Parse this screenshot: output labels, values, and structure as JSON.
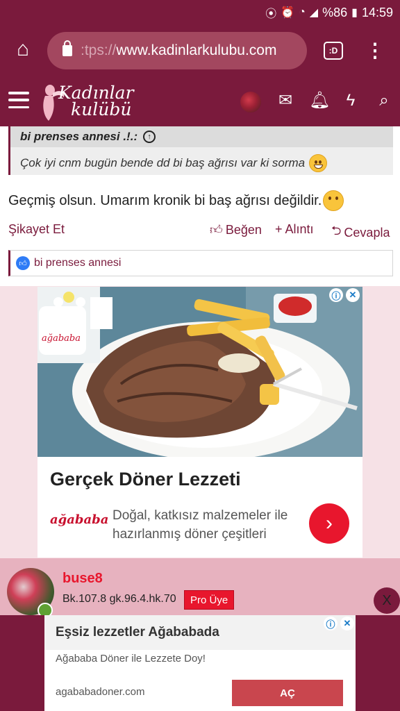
{
  "status_bar": {
    "battery": "%86",
    "time": "14:59"
  },
  "browser": {
    "url_prefix": ":tps://",
    "url_host": "www.kadinlarkulubu.com",
    "tabs_label": ":D"
  },
  "site": {
    "logo_line1": "Kadınlar",
    "logo_line2": "kulübü"
  },
  "post": {
    "quote_author": "bi prenses annesi .!.:",
    "quote_text": "Çok iyi cnm bugün bende dd bi baş ağrısı var ki sorma",
    "message": "Geçmiş olsun. Umarım kronik bi baş ağrısı değildir.",
    "actions": {
      "report": "Şikayet Et",
      "like": "Beğen",
      "quote": "Alıntı",
      "reply": "Cevapla"
    },
    "reactions_user": "bi prenses annesi"
  },
  "ad1": {
    "photo_brand": "ağababa",
    "headline": "Gerçek Döner Lezzeti",
    "brand": "ağababa",
    "description": "Doğal, katkısız malzemeler ile hazırlanmış döner çeşitleri"
  },
  "author": {
    "name": "buse8",
    "stats": "Bk.107.8 gk.96.4.hk.70",
    "badge": "Pro Üye",
    "close": "X"
  },
  "ad2": {
    "title": "Eşsiz lezzetler Ağababada",
    "subtitle": "Ağababa Döner ile Lezzete Doy!",
    "url": "agababadoner.com",
    "button": "AÇ"
  },
  "colors": {
    "brand": "#7a1a3c",
    "accent_red": "#e8162d",
    "author_bar": "#e7b2bf",
    "like_blue": "#2f7cf6"
  },
  "icons": [
    "location-icon",
    "alarm-icon",
    "wifi-icon",
    "signal-icon",
    "battery-icon",
    "home-icon",
    "lock-icon",
    "tabs-icon",
    "kebab-menu-icon",
    "hamburger-icon",
    "mail-icon",
    "bell-icon",
    "lightning-icon",
    "search-icon",
    "like-icon",
    "plus-icon",
    "reply-icon",
    "chevron-right-icon",
    "info-icon",
    "close-icon"
  ]
}
